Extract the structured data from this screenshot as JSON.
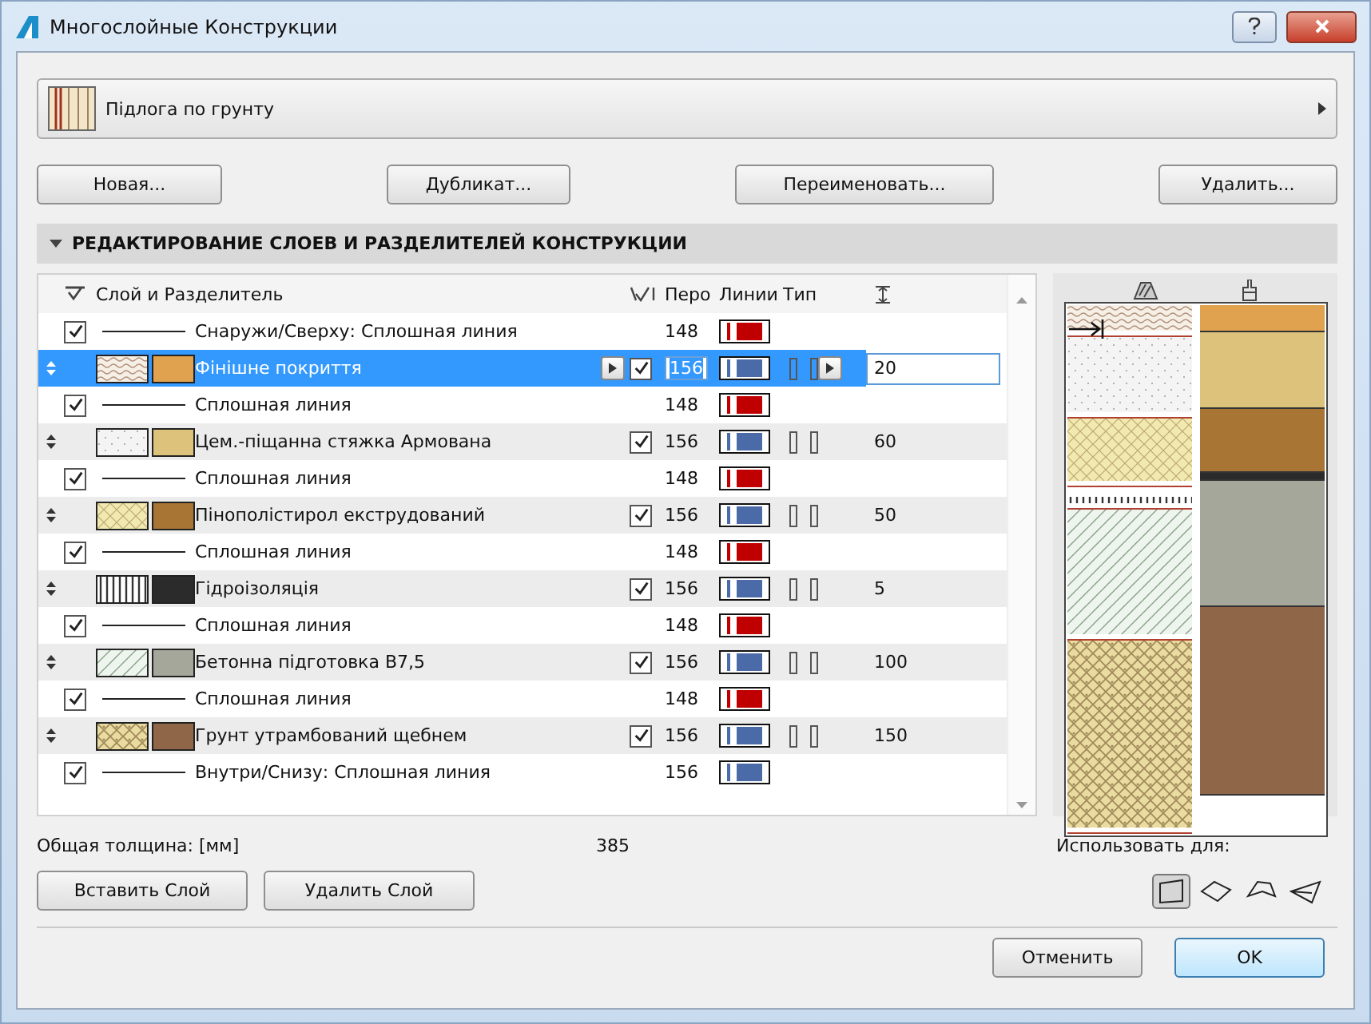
{
  "window": {
    "title": "Многослойные Конструкции"
  },
  "composite": {
    "name": "Підлога по грунту"
  },
  "top_buttons": [
    "Новая...",
    "Дубликат...",
    "Переименовать...",
    "Удалить..."
  ],
  "section": {
    "title": "РЕДАКТИРОВАНИЕ СЛОЕВ И РАЗДЕЛИТЕЛЕЙ КОНСТРУКЦИИ",
    "expanded": true
  },
  "table": {
    "columns": [
      "Слой и Разделитель",
      "Перо",
      "Линии",
      "Тип"
    ],
    "rows": [
      {
        "kind": "separator",
        "checked": true,
        "name": "Снаружи/Сверху: Сплошная линия",
        "pen": "148",
        "color": "#c00000",
        "selected": false
      },
      {
        "kind": "layer",
        "hatch": {
          "kind": "waves"
        },
        "color": "#e0a24e",
        "name": "Фінішне покриття",
        "checked": true,
        "pen": "156",
        "thickness": "20",
        "selected": true
      },
      {
        "kind": "separator",
        "checked": true,
        "name": "Сплошная линия",
        "pen": "148",
        "color": "#c00000",
        "selected": false
      },
      {
        "kind": "layer",
        "hatch": {
          "kind": "dots"
        },
        "color": "#dcc27a",
        "name": "Цем.-піщанна стяжка Армована",
        "checked": true,
        "pen": "156",
        "thickness": "60",
        "selected": false
      },
      {
        "kind": "separator",
        "checked": true,
        "name": "Сплошная линия",
        "pen": "148",
        "color": "#c00000",
        "selected": false
      },
      {
        "kind": "layer",
        "hatch": {
          "kind": "crosshatch"
        },
        "color": "#a87535",
        "name": "Пінополістирол екструдований",
        "checked": true,
        "pen": "156",
        "thickness": "50",
        "selected": false
      },
      {
        "kind": "separator",
        "checked": true,
        "name": "Сплошная линия",
        "pen": "148",
        "color": "#c00000",
        "selected": false
      },
      {
        "kind": "layer",
        "hatch": {
          "kind": "stripes"
        },
        "color": "#2b2b2b",
        "name": "Гідроізоляція",
        "checked": true,
        "pen": "156",
        "thickness": "5",
        "selected": false
      },
      {
        "kind": "separator",
        "checked": true,
        "name": "Сплошная линия",
        "pen": "148",
        "color": "#c00000",
        "selected": false
      },
      {
        "kind": "layer",
        "hatch": {
          "kind": "diagonal"
        },
        "color": "#a5a79a",
        "name": "Бетонна підготовка В7,5",
        "checked": true,
        "pen": "156",
        "thickness": "100",
        "selected": false
      },
      {
        "kind": "separator",
        "checked": true,
        "name": "Сплошная линия",
        "pen": "148",
        "color": "#c00000",
        "selected": false
      },
      {
        "kind": "layer",
        "hatch": {
          "kind": "gravel"
        },
        "color": "#8f6748",
        "name": "Грунт утрамбований щебнем",
        "checked": true,
        "pen": "156",
        "thickness": "150",
        "selected": false
      },
      {
        "kind": "separator",
        "checked": true,
        "name": "Внутри/Снизу: Сплошная линия",
        "pen": "156",
        "color": "#4a6aa8",
        "selected": false
      }
    ]
  },
  "total": {
    "label": "Общая толщина: [мм]",
    "value": "385"
  },
  "use_for": {
    "label": "Использовать для:",
    "options": [
      {
        "selected": true
      },
      {
        "selected": false
      },
      {
        "selected": false
      },
      {
        "selected": false
      }
    ]
  },
  "bottom_buttons": [
    "Вставить Слой",
    "Удалить Слой"
  ],
  "dialog_buttons": [
    {
      "label": "Отменить",
      "default": false
    },
    {
      "label": "OK",
      "default": true
    }
  ]
}
